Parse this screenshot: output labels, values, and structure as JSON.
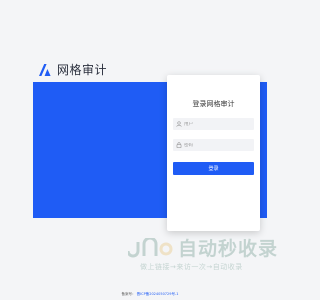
{
  "brand": {
    "logo_icon": "brand-logo-icon",
    "name": "网格审计"
  },
  "colors": {
    "accent": "#1f5cf5",
    "background": "#f4f5f7",
    "card": "#ffffff",
    "watermark": "#1a5f4a"
  },
  "login": {
    "title": "登录网格审计",
    "username": {
      "placeholder": "用户",
      "value": "",
      "icon": "user-icon"
    },
    "password": {
      "placeholder": "密码",
      "value": "",
      "icon": "lock-icon"
    },
    "submit_label": "登录"
  },
  "watermark": {
    "title": "自动秒收录",
    "subtitle": "做上链接→来访一次→自动收录"
  },
  "footer": {
    "prefix": "备案号：",
    "icp": "晋ICP备2024050729号-1"
  }
}
